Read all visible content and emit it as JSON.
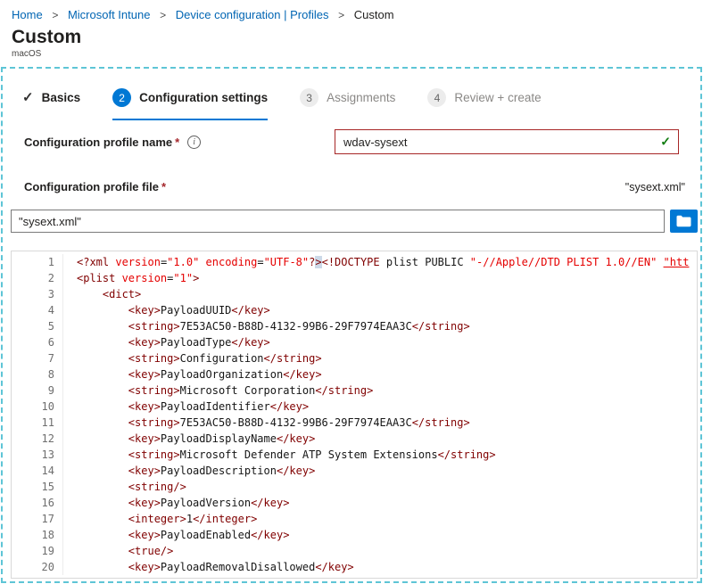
{
  "colors": {
    "breadcrumb_link": "#0065b3",
    "accent_blue": "#0078d4",
    "valid_green": "#107c10",
    "required_red": "#a4262c",
    "name_input_border_red": "#a72626",
    "capture_dashed_teal": "#5ec5d6",
    "code_tag": "#800000",
    "code_attr_string_red": "#e50000",
    "code_text": "#161616",
    "gutter_gray": "#6e6e6e"
  },
  "icons": {
    "info": "i",
    "check": "✓"
  },
  "breadcrumb": {
    "separator": ">",
    "items": [
      {
        "label": "Home"
      },
      {
        "label": "Microsoft Intune"
      },
      {
        "label": "Device configuration | Profiles"
      },
      {
        "label": "Custom"
      }
    ]
  },
  "header": {
    "title": "Custom",
    "subtitle": "macOS"
  },
  "wizard": {
    "steps": [
      {
        "marker": "✓",
        "label": "Basics",
        "state": "completed"
      },
      {
        "marker": "2",
        "label": "Configuration settings",
        "state": "active"
      },
      {
        "marker": "3",
        "label": "Assignments",
        "state": "upcoming"
      },
      {
        "marker": "4",
        "label": "Review + create",
        "state": "upcoming"
      }
    ]
  },
  "form": {
    "name": {
      "label": "Configuration profile name",
      "required_marker": "*",
      "value": "wdav-sysext",
      "valid_icon": "✓"
    },
    "file": {
      "label": "Configuration profile file",
      "required_marker": "*",
      "annotation": "\"sysext.xml\"",
      "value": "\"sysext.xml\""
    }
  },
  "editor": {
    "lines": [
      {
        "n": 1,
        "tokens": [
          [
            "t",
            "<?xml "
          ],
          [
            "a",
            "version"
          ],
          [
            "x",
            "="
          ],
          [
            "s",
            "\"1.0\""
          ],
          [
            "x",
            " "
          ],
          [
            "a",
            "encoding"
          ],
          [
            "x",
            "="
          ],
          [
            "s",
            "\"UTF-8\""
          ],
          [
            "t",
            "?"
          ],
          [
            "h",
            ">"
          ],
          [
            "t",
            "<!DOCTYPE"
          ],
          [
            "x",
            " plist PUBLIC "
          ],
          [
            "s",
            "\"-//Apple//DTD PLIST 1.0//EN\""
          ],
          [
            "x",
            " "
          ],
          [
            "l",
            "\"htt"
          ]
        ]
      },
      {
        "n": 2,
        "tokens": [
          [
            "t",
            "<plist "
          ],
          [
            "a",
            "version"
          ],
          [
            "x",
            "="
          ],
          [
            "s",
            "\"1\""
          ],
          [
            "t",
            ">"
          ]
        ]
      },
      {
        "n": 3,
        "tokens": [
          [
            "x",
            "    "
          ],
          [
            "t",
            "<dict>"
          ]
        ]
      },
      {
        "n": 4,
        "tokens": [
          [
            "x",
            "        "
          ],
          [
            "t",
            "<key>"
          ],
          [
            "x",
            "PayloadUUID"
          ],
          [
            "t",
            "</key>"
          ]
        ]
      },
      {
        "n": 5,
        "tokens": [
          [
            "x",
            "        "
          ],
          [
            "t",
            "<string>"
          ],
          [
            "x",
            "7E53AC50-B88D-4132-99B6-29F7974EAA3C"
          ],
          [
            "t",
            "</string>"
          ]
        ]
      },
      {
        "n": 6,
        "tokens": [
          [
            "x",
            "        "
          ],
          [
            "t",
            "<key>"
          ],
          [
            "x",
            "PayloadType"
          ],
          [
            "t",
            "</key>"
          ]
        ]
      },
      {
        "n": 7,
        "tokens": [
          [
            "x",
            "        "
          ],
          [
            "t",
            "<string>"
          ],
          [
            "x",
            "Configuration"
          ],
          [
            "t",
            "</string>"
          ]
        ]
      },
      {
        "n": 8,
        "tokens": [
          [
            "x",
            "        "
          ],
          [
            "t",
            "<key>"
          ],
          [
            "x",
            "PayloadOrganization"
          ],
          [
            "t",
            "</key>"
          ]
        ]
      },
      {
        "n": 9,
        "tokens": [
          [
            "x",
            "        "
          ],
          [
            "t",
            "<string>"
          ],
          [
            "x",
            "Microsoft Corporation"
          ],
          [
            "t",
            "</string>"
          ]
        ]
      },
      {
        "n": 10,
        "tokens": [
          [
            "x",
            "        "
          ],
          [
            "t",
            "<key>"
          ],
          [
            "x",
            "PayloadIdentifier"
          ],
          [
            "t",
            "</key>"
          ]
        ]
      },
      {
        "n": 11,
        "tokens": [
          [
            "x",
            "        "
          ],
          [
            "t",
            "<string>"
          ],
          [
            "x",
            "7E53AC50-B88D-4132-99B6-29F7974EAA3C"
          ],
          [
            "t",
            "</string>"
          ]
        ]
      },
      {
        "n": 12,
        "tokens": [
          [
            "x",
            "        "
          ],
          [
            "t",
            "<key>"
          ],
          [
            "x",
            "PayloadDisplayName"
          ],
          [
            "t",
            "</key>"
          ]
        ]
      },
      {
        "n": 13,
        "tokens": [
          [
            "x",
            "        "
          ],
          [
            "t",
            "<string>"
          ],
          [
            "x",
            "Microsoft Defender ATP System Extensions"
          ],
          [
            "t",
            "</string>"
          ]
        ]
      },
      {
        "n": 14,
        "tokens": [
          [
            "x",
            "        "
          ],
          [
            "t",
            "<key>"
          ],
          [
            "x",
            "PayloadDescription"
          ],
          [
            "t",
            "</key>"
          ]
        ]
      },
      {
        "n": 15,
        "tokens": [
          [
            "x",
            "        "
          ],
          [
            "t",
            "<string/>"
          ]
        ]
      },
      {
        "n": 16,
        "tokens": [
          [
            "x",
            "        "
          ],
          [
            "t",
            "<key>"
          ],
          [
            "x",
            "PayloadVersion"
          ],
          [
            "t",
            "</key>"
          ]
        ]
      },
      {
        "n": 17,
        "tokens": [
          [
            "x",
            "        "
          ],
          [
            "t",
            "<integer>"
          ],
          [
            "x",
            "1"
          ],
          [
            "t",
            "</integer>"
          ]
        ]
      },
      {
        "n": 18,
        "tokens": [
          [
            "x",
            "        "
          ],
          [
            "t",
            "<key>"
          ],
          [
            "x",
            "PayloadEnabled"
          ],
          [
            "t",
            "</key>"
          ]
        ]
      },
      {
        "n": 19,
        "tokens": [
          [
            "x",
            "        "
          ],
          [
            "t",
            "<true/>"
          ]
        ]
      },
      {
        "n": 20,
        "tokens": [
          [
            "x",
            "        "
          ],
          [
            "t",
            "<key>"
          ],
          [
            "x",
            "PayloadRemovalDisallowed"
          ],
          [
            "t",
            "</key>"
          ]
        ]
      }
    ]
  }
}
